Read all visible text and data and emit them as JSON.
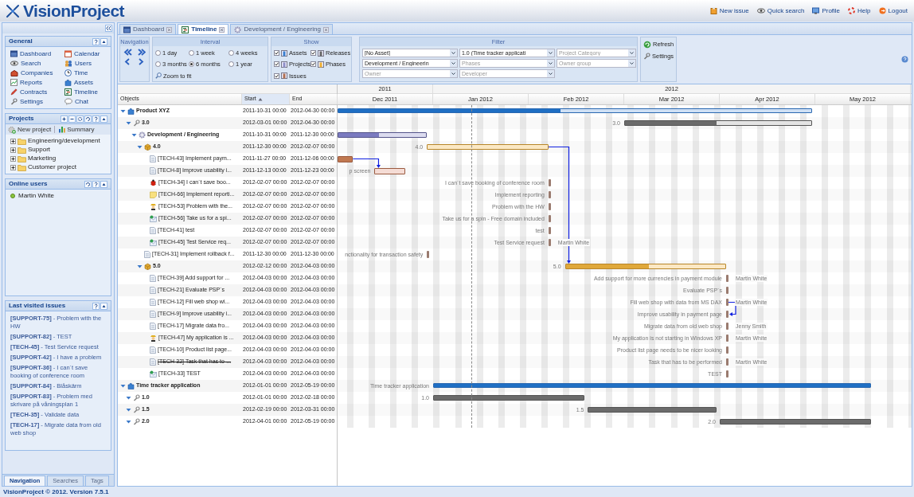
{
  "app": {
    "logo": "VisionProject",
    "links": [
      {
        "label": "New issue"
      },
      {
        "label": "Quick search"
      },
      {
        "label": "Profile"
      },
      {
        "label": "Help"
      },
      {
        "label": "Logout"
      }
    ]
  },
  "sidebar": {
    "general": {
      "title": "General",
      "items": [
        "Dashboard",
        "Calendar",
        "Search",
        "Users",
        "Companies",
        "Time",
        "Reports",
        "Assets",
        "Contracts",
        "Timeline",
        "Settings",
        "Chat"
      ]
    },
    "projects": {
      "title": "Projects",
      "actions": [
        "New project",
        "Summary"
      ],
      "folders": [
        {
          "label": "Engineering/development",
          "expanded": false
        },
        {
          "label": "Support",
          "expanded": false
        },
        {
          "label": "Marketing",
          "expanded": false
        },
        {
          "label": "Customer project",
          "expanded": false
        }
      ]
    },
    "online_users": {
      "title": "Online users",
      "users": [
        "Martin White"
      ]
    },
    "last_visited": {
      "title": "Last visited issues",
      "items": [
        "**[SUPPORT-75]** - Problem with the HW",
        "**[SUPPORT-82]** - TEST",
        "**[TECH-45]** - Test Service request",
        "**[SUPPORT-42]** - I have a problem",
        "**[SUPPORT-36]** - I can´t save booking of conference room",
        "**[SUPPORT-84]** - Blåskärm",
        "**[SUPPORT-83]** - Problem med skrivare på våningsplan 1",
        "**[TECH-35]** - Validate data",
        "**[TECH-17]** - Migrate data from old web shop"
      ]
    },
    "tabs": [
      {
        "label": "Navigation",
        "selected": true
      },
      {
        "label": "Searches",
        "selected": false
      },
      {
        "label": "Tags",
        "selected": false
      }
    ]
  },
  "tabs": [
    {
      "label": "Dashboard",
      "selected": false
    },
    {
      "label": "Timeline",
      "selected": true
    },
    {
      "label": "Development / Engineering",
      "selected": false
    }
  ],
  "toolbar": {
    "navigation": {
      "title": "Navigation"
    },
    "interval": {
      "title": "Interval",
      "options": [
        {
          "label": "1 day",
          "selected": false
        },
        {
          "label": "1 week",
          "selected": false
        },
        {
          "label": "4 weeks",
          "selected": false
        },
        {
          "label": "3 months",
          "selected": false
        },
        {
          "label": "6 months",
          "selected": true
        },
        {
          "label": "1 year",
          "selected": false
        }
      ],
      "zoom": "Zoom to fit"
    },
    "show": {
      "title": "Show",
      "options": [
        {
          "label": "Assets",
          "checked": true
        },
        {
          "label": "Releases",
          "checked": true
        },
        {
          "label": "Projects",
          "checked": true
        },
        {
          "label": "Phases",
          "checked": true
        },
        {
          "label": "Issues",
          "checked": true
        }
      ]
    },
    "filter": {
      "title": "Filter",
      "fields": [
        {
          "value": "[No Asset]"
        },
        {
          "value": "1.0 (Time tracker applicati"
        },
        {
          "placeholder": "Project Category"
        },
        {
          "value": "Development / Engineerin"
        },
        {
          "placeholder": "Phases"
        },
        {
          "placeholder": "Owner group"
        },
        {
          "placeholder": "Owner"
        },
        {
          "placeholder": "Developer"
        }
      ]
    },
    "actions": [
      "Refresh",
      "Settings"
    ]
  },
  "timeline": {
    "columns": [
      {
        "label": "Objects",
        "sorted": false
      },
      {
        "label": "Start",
        "sorted": true
      },
      {
        "label": "End",
        "sorted": false
      }
    ],
    "years": [
      {
        "label": "2011",
        "months": [
          "Dec 2011"
        ]
      },
      {
        "label": "2012",
        "months": [
          "Jan 2012",
          "Feb 2012",
          "Mar 2012",
          "Apr 2012",
          "May 2012"
        ]
      }
    ],
    "rows": [
      {
        "kind": "asset",
        "label": "Product XYZ",
        "start": "2011-10-31 00:00",
        "end": "2012-04-30 00:00",
        "level": 0.47,
        "expanded": true,
        "children": [
          {
            "kind": "release",
            "label": "3.0",
            "start": "2012-03-01 00:00",
            "end": "2012-04-30 00:00",
            "level": 0.49,
            "bar_label": "3.0",
            "expanded": true,
            "children": [
              {
                "kind": "project",
                "label": "Development / Engineering",
                "start": "2011-10-31 00:00",
                "end": "2011-12-30 00:00",
                "level": 0.46,
                "expanded": true,
                "children": [
                  {
                    "kind": "phase",
                    "label": "4.0",
                    "start": "2011-12-30 00:00",
                    "end": "2012-02-07 00:00",
                    "level": 0,
                    "bar_label": "4.0",
                    "has_successor": true,
                    "expanded": true,
                    "children": [
                      {
                        "kind": "task",
                        "label": "[TECH-43] Implement paym...",
                        "start": "2011-11-27 00:00",
                        "end": "2011-12-06 00:00",
                        "level": 1,
                        "has_successor": true
                      },
                      {
                        "kind": "task",
                        "label": "[TECH-8] Improve usability i...",
                        "start": "2011-12-13 00:00",
                        "end": "2011-12-23 00:00",
                        "level": 0,
                        "bar_label": "p screen",
                        "has_predecessor": true
                      },
                      {
                        "kind": "bug",
                        "label": "[TECH-34] I can´t save boo...",
                        "start": "2012-02-07 00:00",
                        "end": "2012-02-07 00:00",
                        "bar_label": "I can´t save booking of conference room"
                      },
                      {
                        "kind": "idea",
                        "label": "[TECH-66] Implement reporti...",
                        "start": "2012-02-07 00:00",
                        "end": "2012-02-07 00:00",
                        "bar_label": "Implement reporting"
                      },
                      {
                        "kind": "support",
                        "label": "[TECH-53] Problem with the...",
                        "start": "2012-02-07 00:00",
                        "end": "2012-02-07 00:00",
                        "bar_label": "Problem with the HW"
                      },
                      {
                        "kind": "service",
                        "label": "[TECH-56] Take us for a spi...",
                        "start": "2012-02-07 00:00",
                        "end": "2012-02-07 00:00",
                        "bar_label": "Take us for a spin - Free domain included"
                      },
                      {
                        "kind": "task",
                        "label": "[TECH-41] test",
                        "start": "2012-02-07 00:00",
                        "end": "2012-02-07 00:00",
                        "bar_label": "test"
                      },
                      {
                        "kind": "service",
                        "label": "[TECH-45] Test Service req...",
                        "start": "2012-02-07 00:00",
                        "end": "2012-02-07 00:00",
                        "bar_label": "Test Service request",
                        "assignee": "Martin White"
                      }
                    ]
                  },
                  {
                    "kind": "task",
                    "label": "[TECH-31] Implement rollback f...",
                    "start": "2011-12-30 00:00",
                    "end": "2011-12-30 00:00",
                    "bar_label": "nctionality for transaction safety"
                  },
                  {
                    "kind": "phase",
                    "label": "5.0",
                    "start": "2012-02-12 00:00",
                    "end": "2012-04-03 00:00",
                    "level": 0.52,
                    "bar_label": "5.0",
                    "has_predecessor": true,
                    "expanded": true,
                    "children": [
                      {
                        "kind": "task",
                        "label": "[TECH-39] Add support for ...",
                        "start": "2012-04-03 00:00",
                        "end": "2012-04-03 00:00",
                        "bar_label": "Add support for more currencies in payment module",
                        "assignee": "Martin White"
                      },
                      {
                        "kind": "task",
                        "label": "[TECH-21] Evaluate PSP´s",
                        "start": "2012-04-03 00:00",
                        "end": "2012-04-03 00:00",
                        "bar_label": "Evaluate PSP´s"
                      },
                      {
                        "kind": "task",
                        "label": "[TECH-12] Fill web shop wi...",
                        "start": "2012-04-03 00:00",
                        "end": "2012-04-03 00:00",
                        "bar_label": "Fill web shop with data from MS DAX",
                        "assignee": "Martin White",
                        "has_successor": true
                      },
                      {
                        "kind": "task",
                        "label": "[TECH-9] Improve usability i...",
                        "start": "2012-04-03 00:00",
                        "end": "2012-04-03 00:00",
                        "bar_label": "Improve usability in payment page",
                        "has_predecessor": true
                      },
                      {
                        "kind": "task",
                        "label": "[TECH-17] Migrate data fro...",
                        "start": "2012-04-03 00:00",
                        "end": "2012-04-03 00:00",
                        "bar_label": "Migrate data from old web shop",
                        "assignee": "Jenny Smith"
                      },
                      {
                        "kind": "support",
                        "label": "[TECH-47] My application is ...",
                        "start": "2012-04-03 00:00",
                        "end": "2012-04-03 00:00",
                        "bar_label": "My application is not starting in Windows XP",
                        "assignee": "Martin White"
                      },
                      {
                        "kind": "task",
                        "label": "[TECH-10] Product list page...",
                        "start": "2012-04-03 00:00",
                        "end": "2012-04-03 00:00",
                        "bar_label": "Product list page needs to be nicer looking"
                      },
                      {
                        "kind": "task",
                        "label": "[TECH-32] Task that has to-...",
                        "start": "2012-04-03 00:00",
                        "end": "2012-04-03 00:00",
                        "bar_label": "Task that has to be performed",
                        "assignee": "Martin White",
                        "closed": true
                      },
                      {
                        "kind": "service",
                        "label": "[TECH-33] TEST",
                        "start": "2012-04-03 00:00",
                        "end": "2012-04-03 00:00",
                        "bar_label": "TEST"
                      }
                    ]
                  }
                ]
              }
            ]
          }
        ]
      },
      {
        "kind": "asset",
        "label": "Time tracker application",
        "start": "2012-01-01 00:00",
        "end": "2012-05-19 00:00",
        "level": 1,
        "bar_label": "Time tracker application",
        "expanded": true,
        "children": [
          {
            "kind": "release",
            "label": "1.0",
            "start": "2012-01-01 00:00",
            "end": "2012-02-18 00:00",
            "level": 1,
            "bar_label": "1.0",
            "expanded": true
          },
          {
            "kind": "release",
            "label": "1.5",
            "start": "2012-02-19 00:00",
            "end": "2012-03-31 00:00",
            "level": 1,
            "bar_label": "1.5",
            "expanded": true
          },
          {
            "kind": "release",
            "label": "2.0",
            "start": "2012-04-01 00:00",
            "end": "2012-05-19 00:00",
            "level": 1,
            "bar_label": "2.0",
            "expanded": true
          }
        ]
      }
    ]
  },
  "footer": "VisionProject © 2012. Version 7.5.1"
}
